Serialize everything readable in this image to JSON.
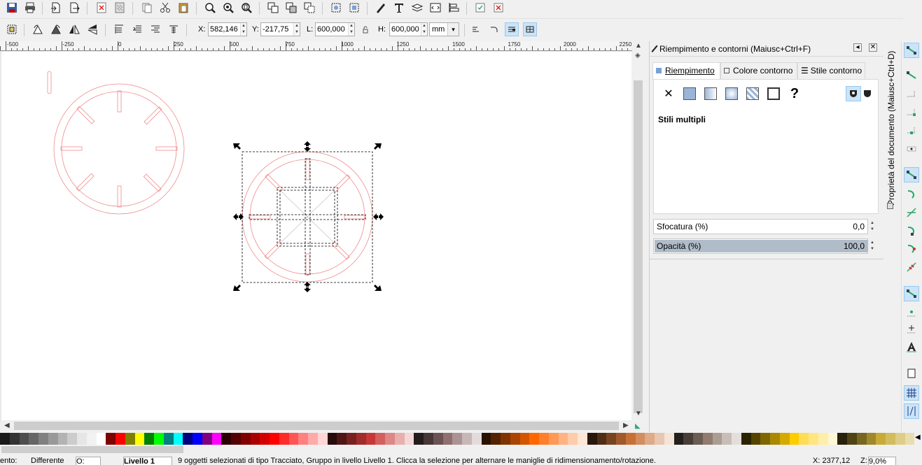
{
  "control_bar": {
    "x_label": "X:",
    "x_value": "582,146",
    "y_label": "Y:",
    "y_value": "-217,75",
    "w_label": "L:",
    "w_value": "600,000",
    "h_label": "H:",
    "h_value": "600,000",
    "unit": "mm"
  },
  "ruler": {
    "labels": [
      "-500",
      "-250",
      "0",
      "250",
      "500",
      "750",
      "1000",
      "1250",
      "1500",
      "1750",
      "2000",
      "2250"
    ]
  },
  "dock": {
    "title": "Riempimento e contorni (Maiusc+Ctrl+F)",
    "tabs": [
      "Riempimento",
      "Colore contorno",
      "Stile contorno"
    ],
    "paint_message": "Stili multipli",
    "unset_symbol": "✕",
    "unknown_symbol": "?",
    "blur_label": "Sfocatura (%)",
    "blur_value": "0,0",
    "opacity_label": "Opacità (%)",
    "opacity_value": "100,0",
    "opacity_fraction": 1.0
  },
  "vertical_tab": "Proprietà del documento (Maiusc+Ctrl+D)",
  "status": {
    "style_label": "ento:",
    "style_value": "Differente",
    "layer_combo": "Livello 1",
    "opacity_combo": "O:",
    "message": "9 oggetti selezionati di tipo Tracciato, Gruppo in livello Livello 1. Clicca la selezione per alternare le maniglie di ridimensionamento/rotazione.",
    "cursor_x": "X: 2377,12",
    "zoom_label": "Z:",
    "zoom_value": "9,0%"
  },
  "palette": [
    "#1a1a1a",
    "#333333",
    "#4d4d4d",
    "#666666",
    "#808080",
    "#999999",
    "#b3b3b3",
    "#cccccc",
    "#e6e6e6",
    "#f2f2f2",
    "#ffffff",
    "#800000",
    "#ff0000",
    "#808000",
    "#ffff00",
    "#008000",
    "#00ff00",
    "#008080",
    "#00ffff",
    "#000080",
    "#0000ff",
    "#800080",
    "#ff00ff",
    "#2b0000",
    "#550000",
    "#800000",
    "#aa0000",
    "#d40000",
    "#ff0000",
    "#ff2a2a",
    "#ff5555",
    "#ff8080",
    "#ffaaaa",
    "#ffd5d5",
    "#280b0b",
    "#501616",
    "#782121",
    "#a02c2c",
    "#c83737",
    "#d35f5f",
    "#de8787",
    "#e9afaf",
    "#f4d7d7",
    "#241c1c",
    "#483737",
    "#6c5353",
    "#916f6f",
    "#ac9393",
    "#c8b7b7",
    "#e3dbdb",
    "#2b1100",
    "#552200",
    "#803300",
    "#aa4400",
    "#d45500",
    "#ff6600",
    "#ff7f2a",
    "#ff9955",
    "#ffb380",
    "#ffccaa",
    "#ffe6d5",
    "#28170b",
    "#502d16",
    "#784421",
    "#a05a2c",
    "#c87137",
    "#d38d5f",
    "#deaa87",
    "#e9c6af",
    "#f4e3d7",
    "#241f1c",
    "#483e37",
    "#6c5d53",
    "#917c6f",
    "#ac9d93",
    "#c8beb7",
    "#e3dedb",
    "#2b2200",
    "#554400",
    "#806600",
    "#aa8800",
    "#d4aa00",
    "#ffcc00",
    "#ffdd55",
    "#ffe680",
    "#ffeeaa",
    "#fff6d5",
    "#28220b",
    "#504416",
    "#786721",
    "#a0892c",
    "#c8ab37",
    "#d3bc5f",
    "#decd87",
    "#e9ddaf"
  ]
}
